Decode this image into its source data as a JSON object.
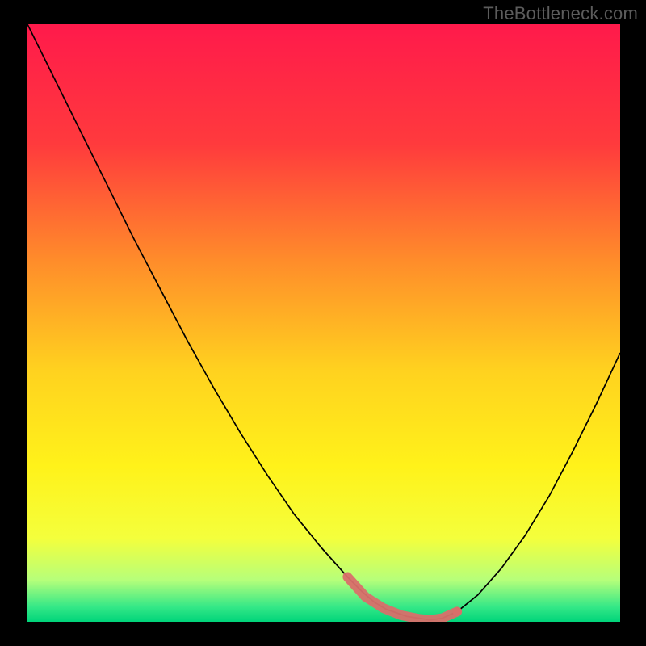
{
  "watermark": "TheBottleneck.com",
  "chart_data": {
    "type": "line",
    "title": "",
    "xlabel": "",
    "ylabel": "",
    "xlim": [
      0,
      100
    ],
    "ylim": [
      0,
      100
    ],
    "grid": false,
    "background_gradient": {
      "stops": [
        {
          "offset": 0.0,
          "color": "#ff1a4b"
        },
        {
          "offset": 0.2,
          "color": "#ff3a3d"
        },
        {
          "offset": 0.4,
          "color": "#ff8e2a"
        },
        {
          "offset": 0.58,
          "color": "#ffd21f"
        },
        {
          "offset": 0.74,
          "color": "#fff21a"
        },
        {
          "offset": 0.86,
          "color": "#f4ff3c"
        },
        {
          "offset": 0.93,
          "color": "#b6ff7a"
        },
        {
          "offset": 0.975,
          "color": "#35e887"
        },
        {
          "offset": 1.0,
          "color": "#00d47a"
        }
      ]
    },
    "series": [
      {
        "name": "bottleneck-curve",
        "color": "#000000",
        "stroke_width": 1.7,
        "x": [
          0.0,
          4.5,
          9.0,
          13.5,
          18.0,
          22.5,
          27.0,
          31.5,
          36.0,
          40.5,
          45.0,
          49.5,
          54.0,
          56.5,
          58.5,
          60.5,
          64.0,
          68.0,
          70.0,
          72.5,
          76.0,
          80.0,
          84.0,
          88.0,
          92.0,
          96.0,
          100.0
        ],
        "y": [
          100.0,
          91.0,
          82.0,
          73.0,
          64.0,
          55.5,
          47.0,
          39.0,
          31.5,
          24.5,
          18.0,
          12.5,
          7.5,
          5.0,
          3.3,
          2.1,
          0.9,
          0.3,
          0.6,
          1.7,
          4.5,
          9.0,
          14.5,
          21.0,
          28.5,
          36.5,
          45.0
        ]
      },
      {
        "name": "highlight-band",
        "color": "#d96f6a",
        "stroke_width": 12,
        "linecap": "round",
        "x": [
          54.0,
          57.0,
          60.0,
          63.0,
          66.0,
          68.0,
          70.0,
          72.5
        ],
        "y": [
          7.5,
          4.2,
          2.3,
          1.1,
          0.5,
          0.3,
          0.6,
          1.7
        ]
      }
    ],
    "markers": [
      {
        "x": 72.5,
        "y": 1.7,
        "r": 5.5,
        "color": "#d96f6a"
      }
    ]
  }
}
